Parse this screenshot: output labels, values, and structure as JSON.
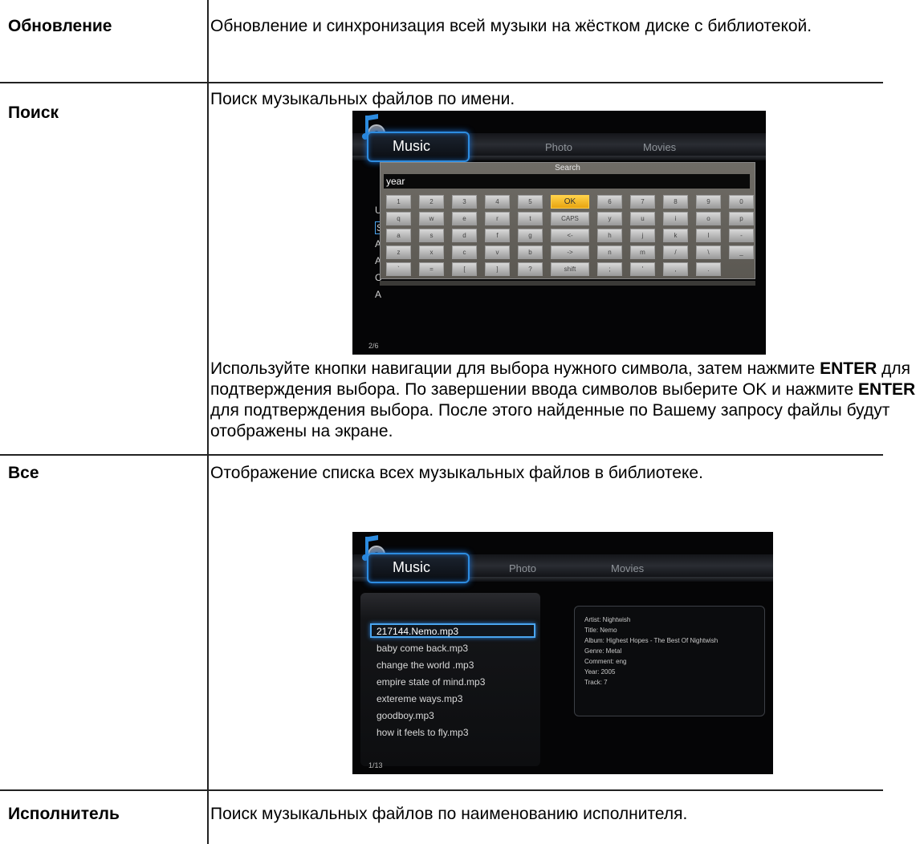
{
  "rows": [
    {
      "term": "Обновление",
      "text": "Обновление и синхронизация всей музыки на жёстком диске с библиотекой."
    },
    {
      "term": "Поиск",
      "text": "Поиск музыкальных файлов по имени.",
      "after": {
        "p1": "Используйте кнопки навигации для выбора нужного символа, затем нажмите ",
        "enter1": "ENTER",
        "p2": " для подтверждения выбора. По завершении ввода символов выберите OK и нажмите ",
        "enter2": "ENTER",
        "p3": " для подтверждения выбора. После этого найденные по Вашему запросу файлы будут отображены на экране."
      }
    },
    {
      "term": "Все",
      "text": "Отображение списка всех музыкальных файлов в библиотеке."
    },
    {
      "term": "Исполнитель",
      "text": "Поиск музыкальных файлов по наименованию исполнителя."
    }
  ],
  "screens": {
    "tabs": {
      "music": "Music",
      "photo": "Photo",
      "movies": "Movies"
    },
    "search": {
      "title": "Search",
      "input": "year",
      "left_letters": [
        "U",
        "S",
        "A",
        "A",
        "C",
        "A"
      ],
      "pager": "2/6",
      "keys": [
        [
          "1",
          "2",
          "3",
          "4",
          "5",
          "OK",
          "6",
          "7",
          "8",
          "9",
          "0"
        ],
        [
          "q",
          "w",
          "e",
          "r",
          "t",
          "CAPS",
          "y",
          "u",
          "i",
          "o",
          "p"
        ],
        [
          "a",
          "s",
          "d",
          "f",
          "g",
          "<-",
          "h",
          "j",
          "k",
          "l",
          "-"
        ],
        [
          "z",
          "x",
          "c",
          "v",
          "b",
          "->",
          "n",
          "m",
          "/",
          "\\",
          "_"
        ],
        [
          "`",
          "=",
          "[",
          "]",
          "?",
          "shift",
          ";",
          "'",
          ",",
          "."
        ]
      ]
    },
    "list": {
      "items": [
        "217144.Nemo.mp3",
        "baby come back.mp3",
        "change the world .mp3",
        "empire state of mind.mp3",
        "extereme ways.mp3",
        "goodboy.mp3",
        "how it feels to fly.mp3"
      ],
      "info": [
        "Artist: Nightwish",
        "Title: Nemo",
        "Album: Highest Hopes - The Best Of Nightwish",
        "Genre: Metal",
        "Comment: eng",
        "Year: 2005",
        "Track: 7"
      ],
      "pager": "1/13"
    }
  },
  "colors": {
    "accent": "#2d8ce0",
    "key_selected": "#f2b528"
  }
}
